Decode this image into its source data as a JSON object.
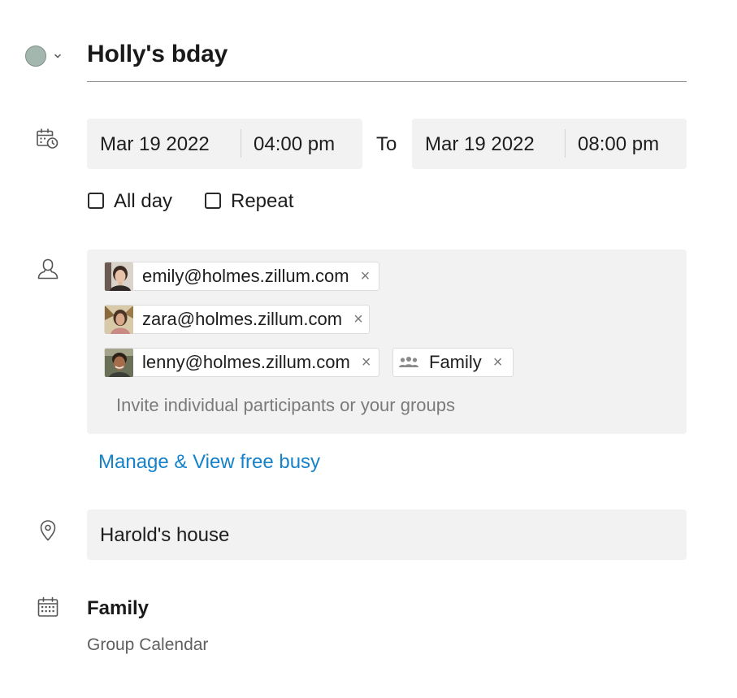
{
  "event": {
    "color": "#a4b7ae",
    "title": "Holly's bday"
  },
  "datetime": {
    "start_date": "Mar 19 2022",
    "start_time": "04:00 pm",
    "to_label": "To",
    "end_date": "Mar 19 2022",
    "end_time": "08:00 pm",
    "all_day": {
      "label": "All day",
      "checked": false
    },
    "repeat": {
      "label": "Repeat",
      "checked": false
    }
  },
  "participants": {
    "chips": [
      {
        "type": "user",
        "label": "emily@holmes.zillum.com",
        "avatar": "avatar-emily"
      },
      {
        "type": "user",
        "label": "zara@holmes.zillum.com",
        "avatar": "avatar-zara"
      },
      {
        "type": "user",
        "label": "lenny@holmes.zillum.com",
        "avatar": "avatar-lenny"
      },
      {
        "type": "group",
        "label": "Family",
        "icon": "group-icon"
      }
    ],
    "remove_glyph": "×",
    "invite_placeholder": "Invite individual participants or your groups",
    "manage_link": "Manage & View free busy"
  },
  "location": {
    "value": "Harold's house"
  },
  "calendar": {
    "name": "Family",
    "type": "Group Calendar"
  },
  "icons": {
    "color_picker_chevron": "chevron-down-icon",
    "datetime": "calendar-clock-icon",
    "participants": "person-icon",
    "location": "location-pin-icon",
    "calendar": "calendar-icon"
  },
  "colors": {
    "field_bg": "#f2f2f2",
    "link": "#1582c9",
    "placeholder": "#7a7a7a"
  }
}
